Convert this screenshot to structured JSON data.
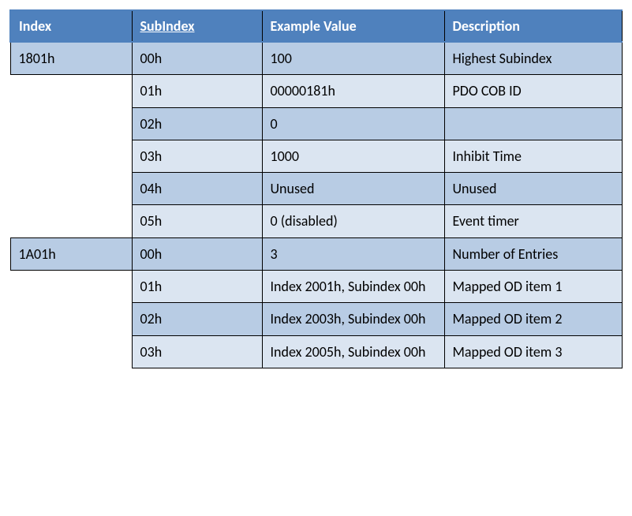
{
  "table": {
    "headers": {
      "index": "Index",
      "subindex": "SubIndex",
      "example": "Example Value",
      "description": "Description"
    },
    "rows": [
      {
        "index": "1801h",
        "sub": "00h",
        "ex": "100",
        "desc": "Highest Subindex",
        "shade": "shade1"
      },
      {
        "index": "",
        "sub": "01h",
        "ex": "00000181h",
        "desc": "PDO COB ID",
        "shade": "shade2"
      },
      {
        "index": "",
        "sub": "02h",
        "ex": "0",
        "desc": "",
        "shade": "shade1"
      },
      {
        "index": "",
        "sub": "03h",
        "ex": "1000",
        "desc": "Inhibit Time",
        "shade": "shade2"
      },
      {
        "index": "",
        "sub": "04h",
        "ex": "Unused",
        "desc": "Unused",
        "shade": "shade1"
      },
      {
        "index": "",
        "sub": "05h",
        "ex": "0 (disabled)",
        "desc": "Event timer",
        "shade": "shade2"
      },
      {
        "index": "1A01h",
        "sub": "00h",
        "ex": "3",
        "desc": "Number of Entries",
        "shade": "shade1"
      },
      {
        "index": "",
        "sub": "01h",
        "ex": "Index 2001h, Subindex 00h",
        "desc": "Mapped OD item 1",
        "shade": "shade2"
      },
      {
        "index": "",
        "sub": "02h",
        "ex": "Index 2003h, Subindex 00h",
        "desc": "Mapped OD item 2",
        "shade": "shade1"
      },
      {
        "index": "",
        "sub": "03h",
        "ex": "Index 2005h, Subindex 00h",
        "desc": "Mapped OD item 3",
        "shade": "shade2"
      }
    ]
  }
}
